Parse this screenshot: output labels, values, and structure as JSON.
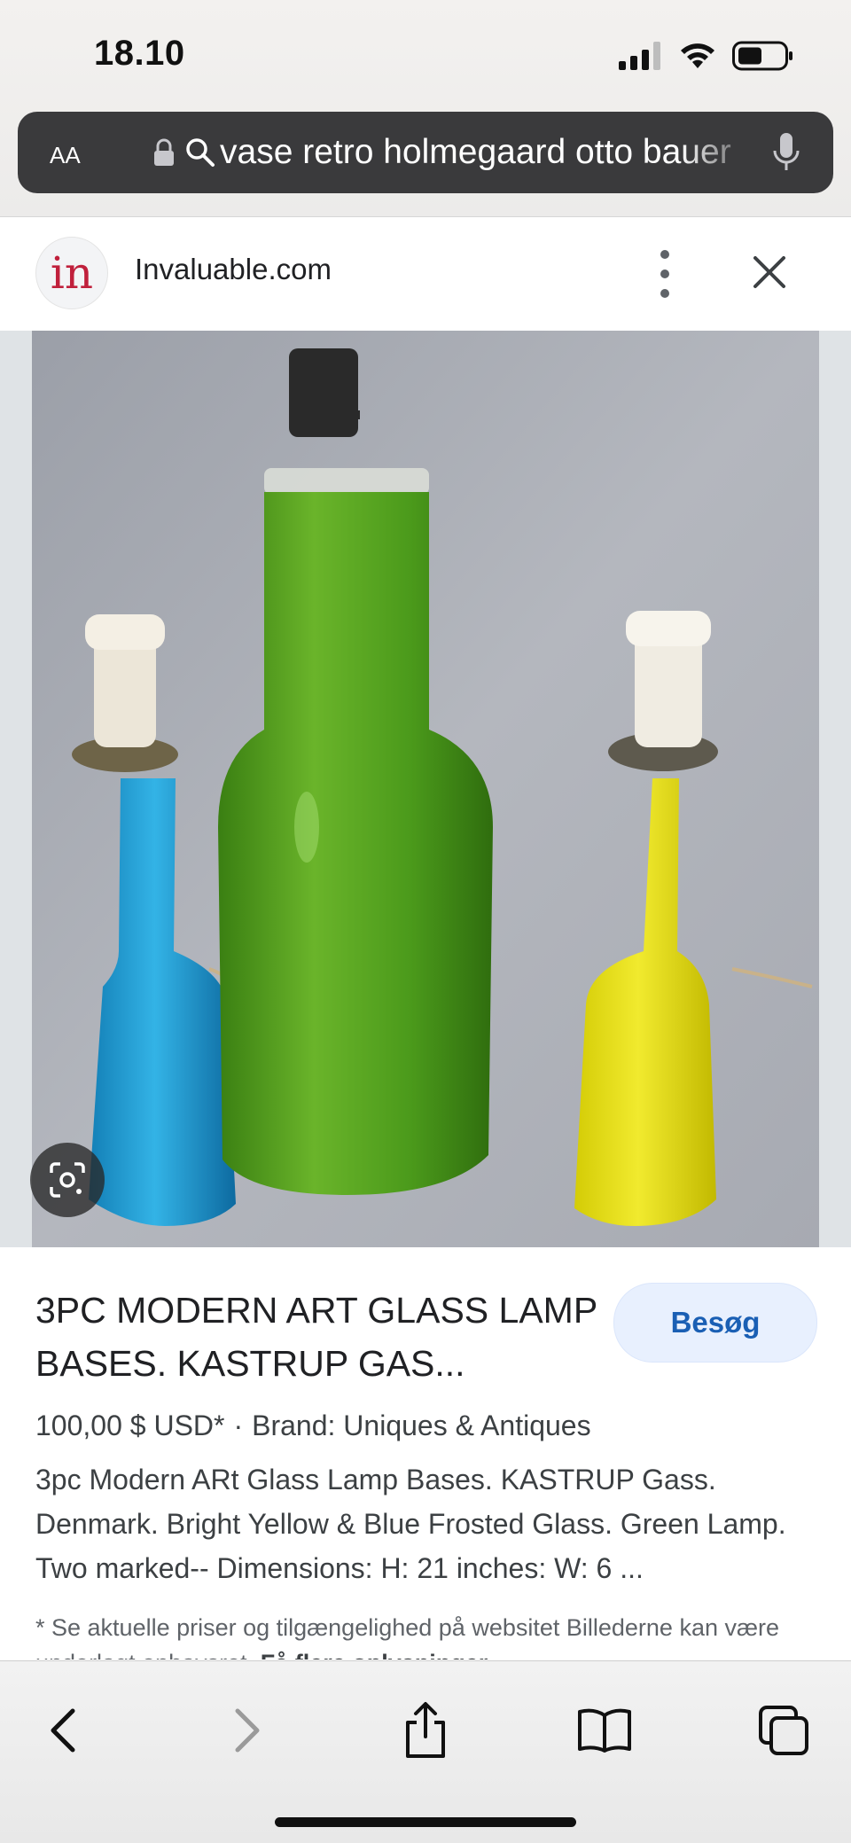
{
  "status_bar": {
    "time": "18.10"
  },
  "url_bar": {
    "aa_label": "AA",
    "query": "vase retro holmegaard otto bauer"
  },
  "site": {
    "logo_text": "in",
    "name": "Invaluable.com"
  },
  "result": {
    "title": "3PC MODERN ART GLASS LAMP BASES. KASTRUP GAS...",
    "visit_label": "Besøg",
    "price": "100,00 $ USD*",
    "separator": "·",
    "brand": "Brand: Uniques & Antiques",
    "description": "3pc Modern ARt Glass Lamp Bases. KASTRUP Gass. Denmark. Bright Yellow & Blue Frosted Glass. Green Lamp. Two marked-- Dimensions: H: 21 inches: W: 6 ...",
    "disclaimer": "* Se aktuelle priser og tilgængelighed på websitet Billederne kan være underlagt ophavsret.",
    "disclaimer_link": "Få flere oplysninger"
  },
  "toolbar": {
    "back_icon": "chevron-left-icon",
    "forward_icon": "chevron-right-icon",
    "share_icon": "share-icon",
    "bookmarks_icon": "book-icon",
    "tabs_icon": "tabs-icon"
  },
  "colors": {
    "url_bar_bg": "#3a3a3c",
    "visit_bg": "#e8f0fe",
    "visit_text": "#1a5fb4",
    "lamp_blue": "#1f9fd6",
    "lamp_green": "#4c9a1c",
    "lamp_yellow": "#e4dc10"
  }
}
